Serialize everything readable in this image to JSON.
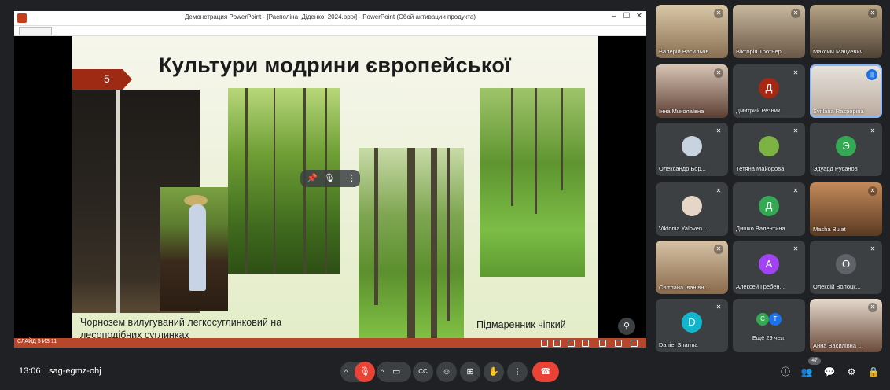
{
  "ppt": {
    "window_title": "Демонстрация PowerPoint - [Располiна_Дiденко_2024.pptx] - PowerPoint (Сбой активации продукта)",
    "win_min": "–",
    "win_max": "☐",
    "win_close": "✕",
    "status_left": "СЛАЙД 5 ИЗ 11",
    "slide": {
      "number": "5",
      "title": "Культури модрини європейської",
      "caption_left_line1": "Чорнозем вилугуваний легкосуглинковий на",
      "caption_left_line2": "лесоподібних суглинках",
      "caption_right": "Підмаренник чіпкий"
    }
  },
  "icons": {
    "more": "⋮",
    "pin": "📌",
    "zoom": "⚲",
    "mic_off": "🎙"
  },
  "participants": [
    {
      "name": "Валерій Васильов",
      "type": "video",
      "speaking": false
    },
    {
      "name": "Вікторія Тротнер",
      "type": "video",
      "speaking": false
    },
    {
      "name": "Максим Мацкевич",
      "type": "video",
      "speaking": false
    },
    {
      "name": "Інна Миколаївна",
      "type": "video",
      "speaking": false
    },
    {
      "name": "Дмитрий Резник",
      "type": "avatar",
      "initial": "Д",
      "color": "#a52714",
      "speaking": false
    },
    {
      "name": "Svitlana Raspopina",
      "type": "video",
      "speaking": true
    },
    {
      "name": "Олександр Бор...",
      "type": "photo",
      "speaking": false
    },
    {
      "name": "Тетяна Майорова",
      "type": "photo",
      "speaking": false
    },
    {
      "name": "Эдуард Русанов",
      "type": "avatar",
      "initial": "Э",
      "color": "#34a853",
      "speaking": false
    },
    {
      "name": "Viktoriia Yaloven...",
      "type": "photo",
      "speaking": false
    },
    {
      "name": "Дишко Валентина",
      "type": "avatar",
      "initial": "Д",
      "color": "#34a853",
      "speaking": false
    },
    {
      "name": "Masha Bulat",
      "type": "video",
      "speaking": false
    },
    {
      "name": "Світлана Іванівн...",
      "type": "video",
      "speaking": false
    },
    {
      "name": "Алексей Гребен...",
      "type": "avatar",
      "initial": "А",
      "color": "#a142f4",
      "speaking": false
    },
    {
      "name": "Олексій Волоцк...",
      "type": "avatar",
      "initial": "О",
      "color": "#5f6368",
      "speaking": false
    },
    {
      "name": "Daniel Sharma",
      "type": "avatar",
      "initial": "D",
      "color": "#12b5cb",
      "speaking": false
    },
    {
      "name": "Ещё 29 чел.",
      "type": "more",
      "initials": [
        "С",
        "Т"
      ],
      "speaking": false
    },
    {
      "name": "Анна Василівна ...",
      "type": "video",
      "speaking": false
    }
  ],
  "bottom_bar": {
    "time": "13:06",
    "separator": "|",
    "meeting_code": "sag-egmz-ohj",
    "participants_badge": "47",
    "buttons": {
      "caret": "^",
      "mic": "🎙",
      "camera": "▭",
      "captions": "CC",
      "emoji": "☺",
      "present": "⊞",
      "hand": "✋",
      "more": "⋮",
      "end_call": "☎"
    },
    "right_icons": {
      "info": "ⓘ",
      "people": "👥",
      "chat": "💬",
      "activities": "⚙",
      "host": "🔒"
    }
  },
  "colors": {
    "meet_bg": "#202124",
    "tile_bg": "#3c4043",
    "end_call": "#ea4335",
    "mic_off": "#ea4335",
    "ppt_accent": "#b7472a",
    "speaking_border": "#8ab4f8"
  }
}
